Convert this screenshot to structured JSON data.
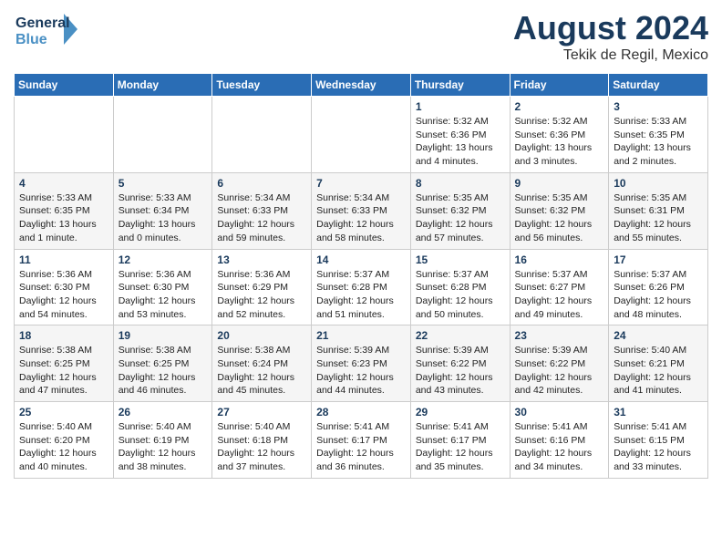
{
  "logo": {
    "line1": "General",
    "line2": "Blue"
  },
  "title": "August 2024",
  "location": "Tekik de Regil, Mexico",
  "days_of_week": [
    "Sunday",
    "Monday",
    "Tuesday",
    "Wednesday",
    "Thursday",
    "Friday",
    "Saturday"
  ],
  "weeks": [
    [
      {
        "day": "",
        "info": ""
      },
      {
        "day": "",
        "info": ""
      },
      {
        "day": "",
        "info": ""
      },
      {
        "day": "",
        "info": ""
      },
      {
        "day": "1",
        "info": "Sunrise: 5:32 AM\nSunset: 6:36 PM\nDaylight: 13 hours\nand 4 minutes."
      },
      {
        "day": "2",
        "info": "Sunrise: 5:32 AM\nSunset: 6:36 PM\nDaylight: 13 hours\nand 3 minutes."
      },
      {
        "day": "3",
        "info": "Sunrise: 5:33 AM\nSunset: 6:35 PM\nDaylight: 13 hours\nand 2 minutes."
      }
    ],
    [
      {
        "day": "4",
        "info": "Sunrise: 5:33 AM\nSunset: 6:35 PM\nDaylight: 13 hours\nand 1 minute."
      },
      {
        "day": "5",
        "info": "Sunrise: 5:33 AM\nSunset: 6:34 PM\nDaylight: 13 hours\nand 0 minutes."
      },
      {
        "day": "6",
        "info": "Sunrise: 5:34 AM\nSunset: 6:33 PM\nDaylight: 12 hours\nand 59 minutes."
      },
      {
        "day": "7",
        "info": "Sunrise: 5:34 AM\nSunset: 6:33 PM\nDaylight: 12 hours\nand 58 minutes."
      },
      {
        "day": "8",
        "info": "Sunrise: 5:35 AM\nSunset: 6:32 PM\nDaylight: 12 hours\nand 57 minutes."
      },
      {
        "day": "9",
        "info": "Sunrise: 5:35 AM\nSunset: 6:32 PM\nDaylight: 12 hours\nand 56 minutes."
      },
      {
        "day": "10",
        "info": "Sunrise: 5:35 AM\nSunset: 6:31 PM\nDaylight: 12 hours\nand 55 minutes."
      }
    ],
    [
      {
        "day": "11",
        "info": "Sunrise: 5:36 AM\nSunset: 6:30 PM\nDaylight: 12 hours\nand 54 minutes."
      },
      {
        "day": "12",
        "info": "Sunrise: 5:36 AM\nSunset: 6:30 PM\nDaylight: 12 hours\nand 53 minutes."
      },
      {
        "day": "13",
        "info": "Sunrise: 5:36 AM\nSunset: 6:29 PM\nDaylight: 12 hours\nand 52 minutes."
      },
      {
        "day": "14",
        "info": "Sunrise: 5:37 AM\nSunset: 6:28 PM\nDaylight: 12 hours\nand 51 minutes."
      },
      {
        "day": "15",
        "info": "Sunrise: 5:37 AM\nSunset: 6:28 PM\nDaylight: 12 hours\nand 50 minutes."
      },
      {
        "day": "16",
        "info": "Sunrise: 5:37 AM\nSunset: 6:27 PM\nDaylight: 12 hours\nand 49 minutes."
      },
      {
        "day": "17",
        "info": "Sunrise: 5:37 AM\nSunset: 6:26 PM\nDaylight: 12 hours\nand 48 minutes."
      }
    ],
    [
      {
        "day": "18",
        "info": "Sunrise: 5:38 AM\nSunset: 6:25 PM\nDaylight: 12 hours\nand 47 minutes."
      },
      {
        "day": "19",
        "info": "Sunrise: 5:38 AM\nSunset: 6:25 PM\nDaylight: 12 hours\nand 46 minutes."
      },
      {
        "day": "20",
        "info": "Sunrise: 5:38 AM\nSunset: 6:24 PM\nDaylight: 12 hours\nand 45 minutes."
      },
      {
        "day": "21",
        "info": "Sunrise: 5:39 AM\nSunset: 6:23 PM\nDaylight: 12 hours\nand 44 minutes."
      },
      {
        "day": "22",
        "info": "Sunrise: 5:39 AM\nSunset: 6:22 PM\nDaylight: 12 hours\nand 43 minutes."
      },
      {
        "day": "23",
        "info": "Sunrise: 5:39 AM\nSunset: 6:22 PM\nDaylight: 12 hours\nand 42 minutes."
      },
      {
        "day": "24",
        "info": "Sunrise: 5:40 AM\nSunset: 6:21 PM\nDaylight: 12 hours\nand 41 minutes."
      }
    ],
    [
      {
        "day": "25",
        "info": "Sunrise: 5:40 AM\nSunset: 6:20 PM\nDaylight: 12 hours\nand 40 minutes."
      },
      {
        "day": "26",
        "info": "Sunrise: 5:40 AM\nSunset: 6:19 PM\nDaylight: 12 hours\nand 38 minutes."
      },
      {
        "day": "27",
        "info": "Sunrise: 5:40 AM\nSunset: 6:18 PM\nDaylight: 12 hours\nand 37 minutes."
      },
      {
        "day": "28",
        "info": "Sunrise: 5:41 AM\nSunset: 6:17 PM\nDaylight: 12 hours\nand 36 minutes."
      },
      {
        "day": "29",
        "info": "Sunrise: 5:41 AM\nSunset: 6:17 PM\nDaylight: 12 hours\nand 35 minutes."
      },
      {
        "day": "30",
        "info": "Sunrise: 5:41 AM\nSunset: 6:16 PM\nDaylight: 12 hours\nand 34 minutes."
      },
      {
        "day": "31",
        "info": "Sunrise: 5:41 AM\nSunset: 6:15 PM\nDaylight: 12 hours\nand 33 minutes."
      }
    ]
  ]
}
